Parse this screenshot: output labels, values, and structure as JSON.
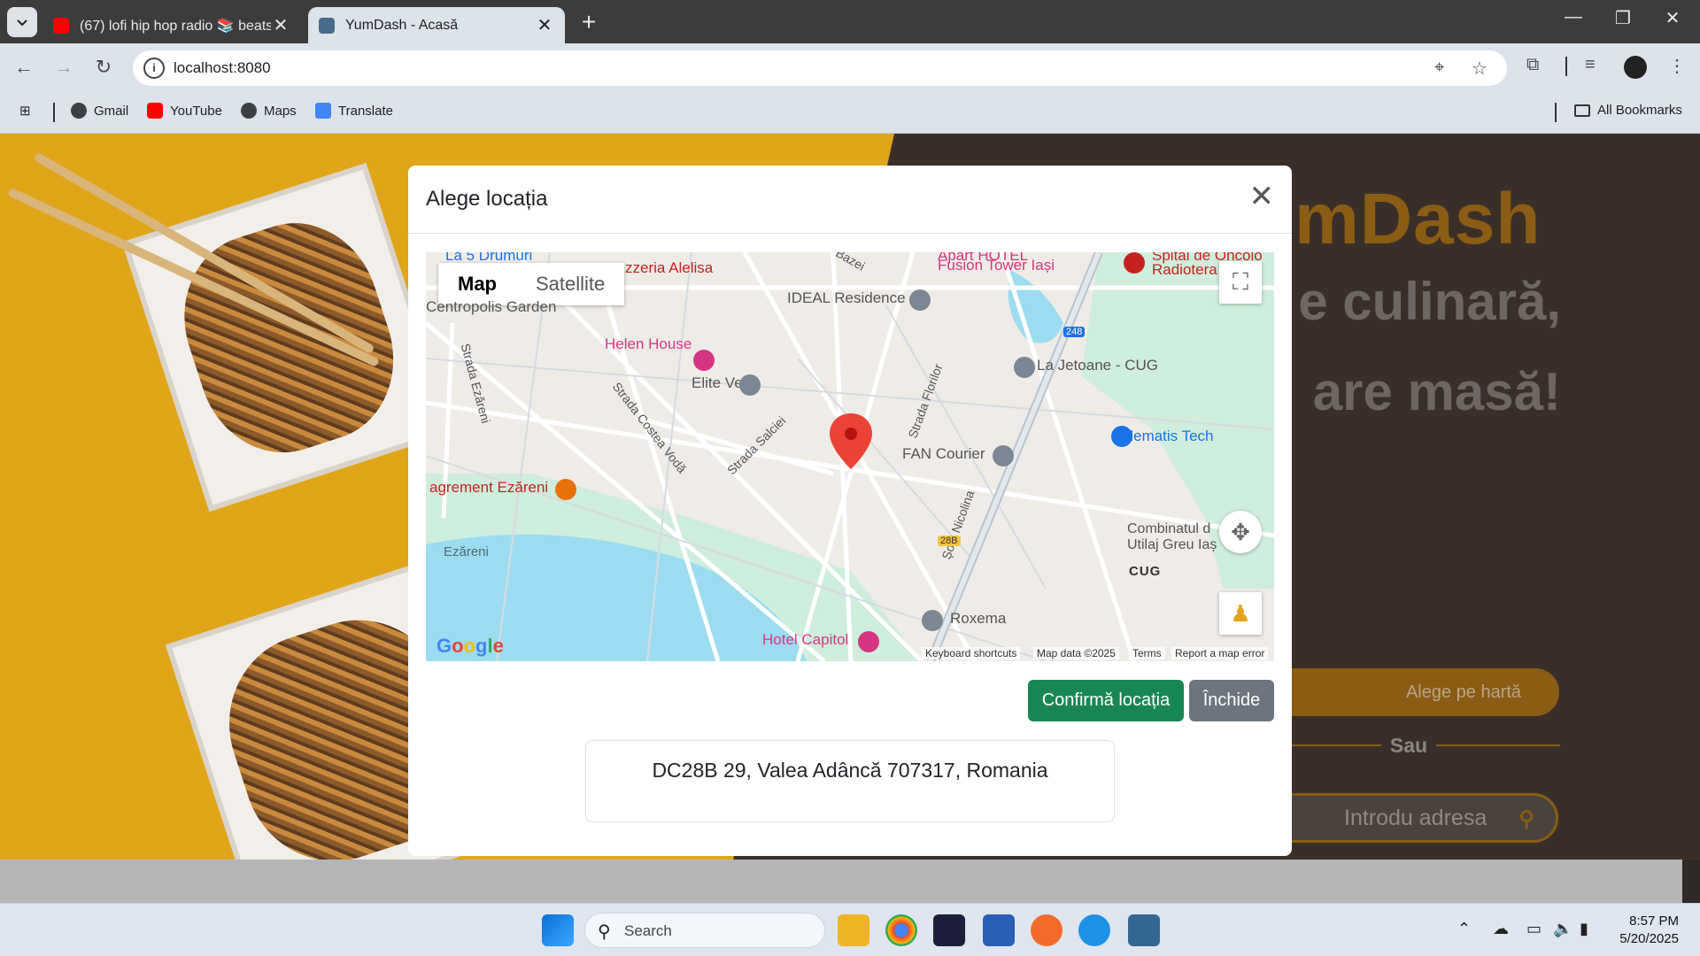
{
  "browser": {
    "tabs": [
      {
        "title": "(67) lofi hip hop radio 📚 beats",
        "active": false,
        "favicon": "youtube-icon"
      },
      {
        "title": "YumDash - Acasă",
        "active": true,
        "favicon": "yumdash-icon"
      }
    ],
    "address": "localhost:8080",
    "bookmarks": [
      {
        "label": "Gmail",
        "icon": "globe-icon"
      },
      {
        "label": "YouTube",
        "icon": "youtube-icon"
      },
      {
        "label": "Maps",
        "icon": "globe-icon"
      },
      {
        "label": "Translate",
        "icon": "translate-icon"
      }
    ],
    "all_bookmarks": "All Bookmarks"
  },
  "hero": {
    "title": "mDash",
    "line1": "e culinară,",
    "line2": "are masă!",
    "choose_on_map": "Alege pe hartă",
    "separator": "Sau",
    "address_placeholder": "Introdu adresa"
  },
  "modal": {
    "title": "Alege locația",
    "maptype": {
      "map": "Map",
      "satellite": "Satellite"
    },
    "map_labels": {
      "la5drumuri": "La 5 Drumuri",
      "pizzeria": "zzeria Alelisa",
      "bazei": "Bazei",
      "fusion": "Fusion Tower Iași",
      "aparthotel": "Apart HOTEL",
      "spital": "Spital de Oncolo",
      "radiotera": "Radiotera",
      "centropolis": "Centropolis Garden",
      "ideal": "IDEAL Residence",
      "helen": "Helen House",
      "eliteVet": "Elite Vet",
      "jetoane": "La Jetoane - CUG",
      "strada_ezareni": "Strada Ezăreni",
      "costea": "Strada Costea Vodă",
      "salciei": "Strada Salciei",
      "florilor": "Strada Florilor",
      "fan": "FAN Courier",
      "elematis": "Elematis Tech",
      "agrement": "agrement Ezăreni",
      "ezareni": "Ezăreni",
      "nicolina": "Șos. Nicolina",
      "combinatul1": "Combinatul d",
      "combinatul2": "Utilaj Greu Iaș",
      "cug": "CUG",
      "roxema": "Roxema",
      "hotelcapitol": "Hotel Capitol",
      "road248": "248",
      "road28b": "28B"
    },
    "map_footer": {
      "google": "Google",
      "shortcuts": "Keyboard shortcuts",
      "data": "Map data ©2025",
      "terms": "Terms",
      "report": "Report a map error"
    },
    "confirm": "Confirmă locația",
    "close": "Închide",
    "address": "DC28B 29, Valea Adâncă 707317, Romania"
  },
  "taskbar": {
    "search": "Search",
    "time": "8:57 PM",
    "date": "5/20/2025"
  },
  "colors": {
    "brand": "#8a5c14",
    "confirm": "#198754",
    "close": "#6c757d",
    "marker": "#ea4335"
  }
}
